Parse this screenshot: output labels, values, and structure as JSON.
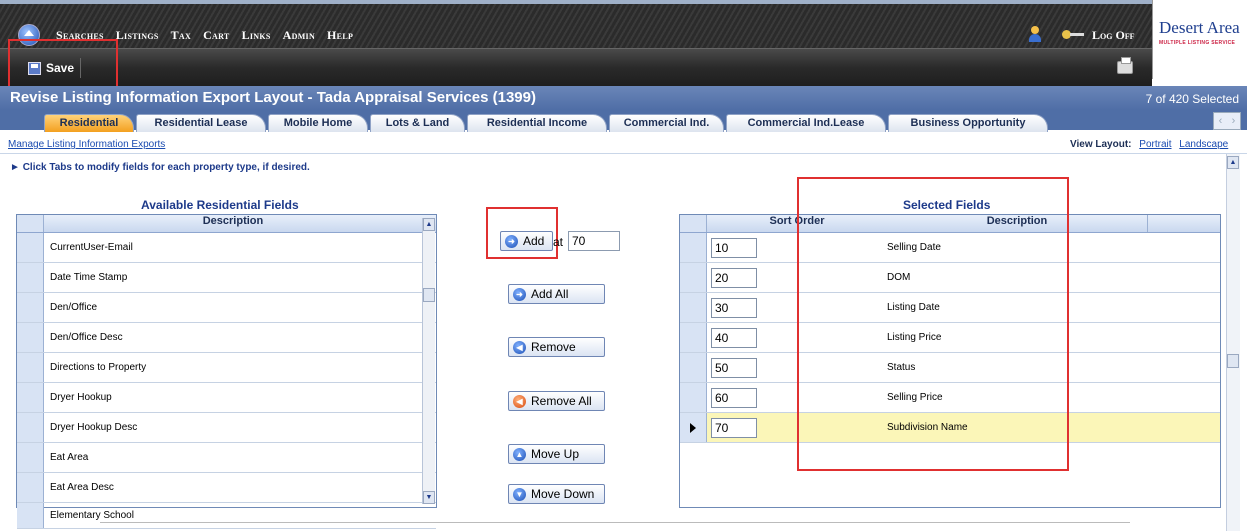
{
  "brand": {
    "name": "Desert Area",
    "tagline": "MULTIPLE LISTING SERVICE"
  },
  "nav": {
    "menu": [
      "Searches",
      "Listings",
      "Tax",
      "Cart",
      "Links",
      "Admin",
      "Help"
    ],
    "logoff": "Log Off"
  },
  "toolbar": {
    "save_label": "Save"
  },
  "header": {
    "title": "Revise Listing Information Export Layout - Tada Appraisal Services (1399)",
    "selection": "7 of 420 Selected"
  },
  "tabs": [
    "Residential",
    "Residential Lease",
    "Mobile Home",
    "Lots & Land",
    "Residential Income",
    "Commercial Ind.",
    "Commercial Ind.Lease",
    "Business Opportunity"
  ],
  "active_tab": "Residential",
  "subbar": {
    "manage_link": "Manage Listing Information Exports",
    "view_layout_label": "View Layout:",
    "portrait": "Portrait",
    "landscape": "Landscape"
  },
  "hint": "Click Tabs to modify fields for each property type, if desired.",
  "available": {
    "title": "Available Residential Fields",
    "column": "Description",
    "items": [
      "CurrentUser-Email",
      "Date Time Stamp",
      "Den/Office",
      "Den/Office Desc",
      "Directions to Property",
      "Dryer Hookup",
      "Dryer Hookup Desc",
      "Eat Area",
      "Eat Area Desc",
      "Elementary School"
    ]
  },
  "actions": {
    "add": "Add",
    "at": "at",
    "at_value": "70",
    "add_all": "Add All",
    "remove": "Remove",
    "remove_all": "Remove All",
    "move_up": "Move Up",
    "move_down": "Move Down"
  },
  "selected": {
    "title": "Selected Fields",
    "columns": [
      "Sort Order",
      "Description"
    ],
    "rows": [
      {
        "order": "10",
        "desc": "Selling Date"
      },
      {
        "order": "20",
        "desc": "DOM"
      },
      {
        "order": "30",
        "desc": "Listing Date"
      },
      {
        "order": "40",
        "desc": "Listing Price"
      },
      {
        "order": "50",
        "desc": "Status"
      },
      {
        "order": "60",
        "desc": "Selling Price"
      },
      {
        "order": "70",
        "desc": "Subdivision Name"
      }
    ]
  }
}
